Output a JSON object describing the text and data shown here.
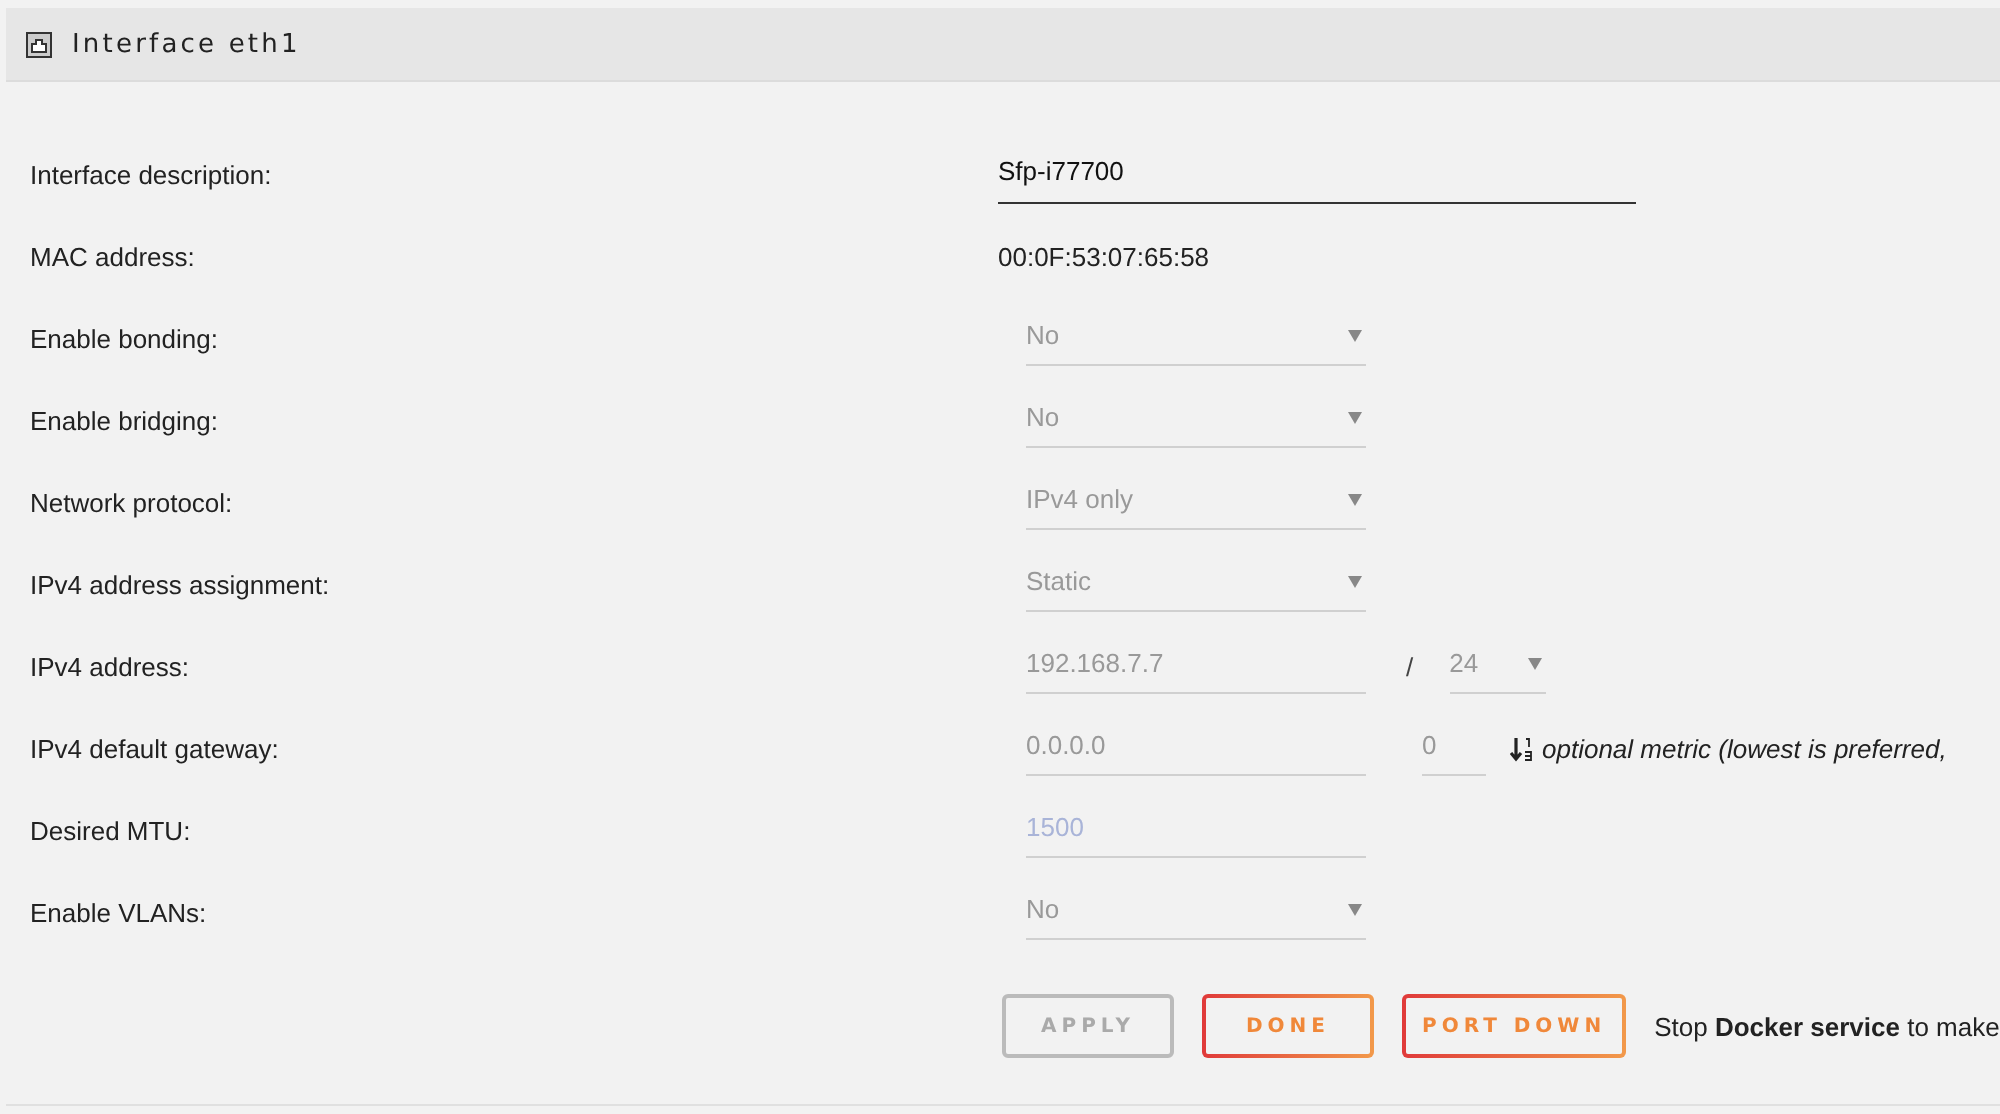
{
  "panel": {
    "title": "Interface eth1"
  },
  "rows": [
    {
      "kind": "text",
      "label": "Interface description:",
      "value": "Sfp-i77700"
    },
    {
      "kind": "static",
      "label": "MAC address:",
      "value": "00:0F:53:07:65:58"
    },
    {
      "kind": "select",
      "label": "Enable bonding:",
      "value": "No"
    },
    {
      "kind": "select",
      "label": "Enable bridging:",
      "value": "No"
    },
    {
      "kind": "select",
      "label": "Network protocol:",
      "value": "IPv4 only"
    },
    {
      "kind": "select",
      "label": "IPv4 address assignment:",
      "value": "Static"
    },
    {
      "kind": "address",
      "label": "IPv4 address:",
      "value": "192.168.7.7",
      "separator": "/",
      "prefix": "24"
    },
    {
      "kind": "gateway",
      "label": "IPv4 default gateway:",
      "value": "0.0.0.0",
      "metric": "0",
      "note": "optional metric (lowest is preferred,"
    },
    {
      "kind": "number",
      "label": "Desired MTU:",
      "placeholder": "1500"
    },
    {
      "kind": "select",
      "label": "Enable VLANs:",
      "value": "No"
    }
  ],
  "buttons": [
    {
      "label": "APPLY",
      "disabled": true
    },
    {
      "label": "DONE",
      "disabled": false
    },
    {
      "label": "PORT DOWN",
      "disabled": false
    }
  ],
  "note": "Stop **Docker service** to make"
}
